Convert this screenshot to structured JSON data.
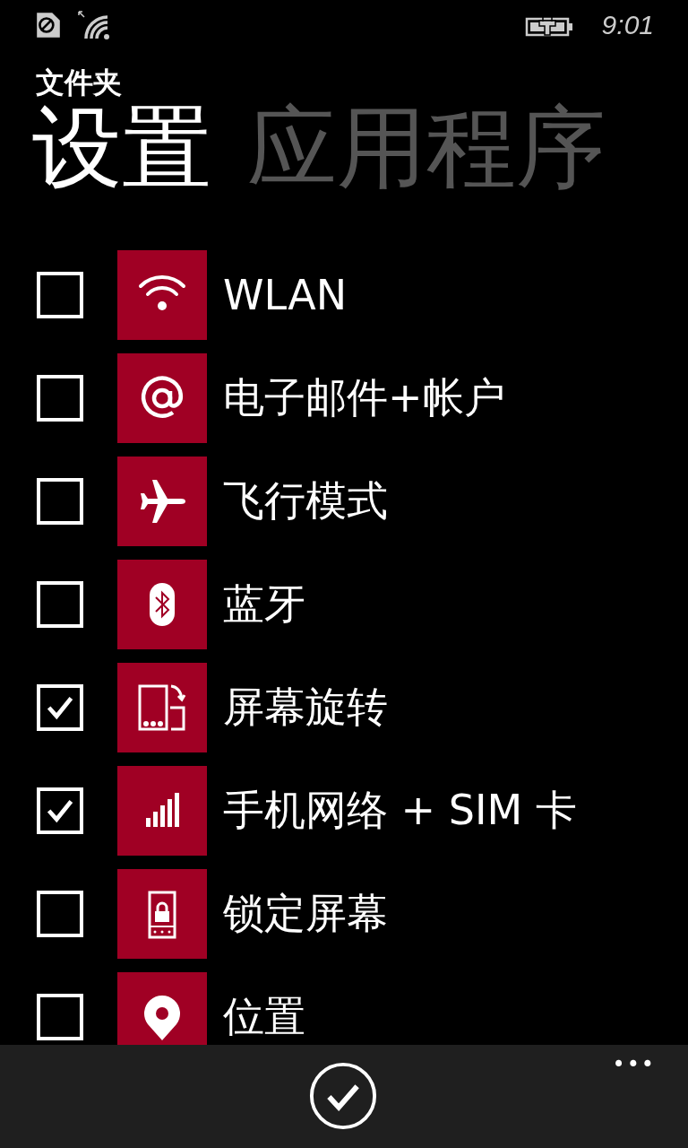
{
  "status_bar": {
    "time": "9:01"
  },
  "header": {
    "folder_label": "文件夹"
  },
  "pivot": [
    {
      "label": "设置",
      "selected": true
    },
    {
      "label": "应用程序",
      "selected": false
    }
  ],
  "items": [
    {
      "label": "WLAN",
      "kind": "wifi",
      "checked": false
    },
    {
      "label": "电子邮件+帐户",
      "kind": "email",
      "checked": false
    },
    {
      "label": "飞行模式",
      "kind": "airplane",
      "checked": false
    },
    {
      "label": "蓝牙",
      "kind": "bluetooth",
      "checked": false
    },
    {
      "label": "屏幕旋转",
      "kind": "rotation",
      "checked": true
    },
    {
      "label": "手机网络 + SIM 卡",
      "kind": "cellular",
      "checked": true
    },
    {
      "label": "锁定屏幕",
      "kind": "lock",
      "checked": false
    },
    {
      "label": "位置",
      "kind": "location",
      "checked": false
    }
  ],
  "app_bar": {
    "more": "•••"
  }
}
